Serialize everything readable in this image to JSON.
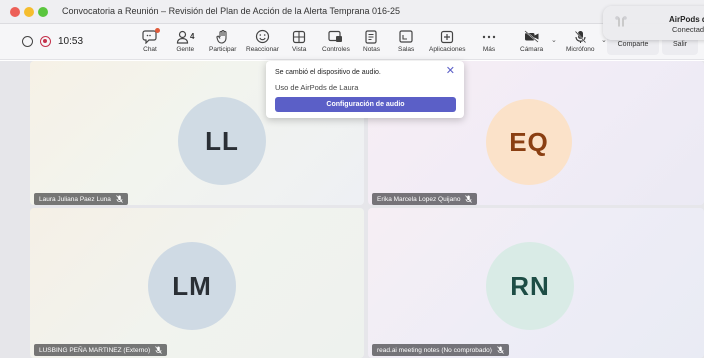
{
  "window": {
    "title": "Convocatoria a Reunión – Revisión del Plan de Acción de la Alerta Temprana 016-25"
  },
  "toolbar": {
    "timer": "10:53",
    "people_count": "4",
    "buttons": [
      {
        "label": "Chat",
        "icon": "chat-icon"
      },
      {
        "label": "Gente",
        "icon": "people-icon"
      },
      {
        "label": "Participar",
        "icon": "raise-hand-icon"
      },
      {
        "label": "Reaccionar",
        "icon": "smiley-icon"
      },
      {
        "label": "Vista",
        "icon": "grid-view-icon"
      },
      {
        "label": "Controles",
        "icon": "controls-icon"
      },
      {
        "label": "Notas",
        "icon": "notes-icon"
      },
      {
        "label": "Salas",
        "icon": "rooms-icon"
      },
      {
        "label": "Aplicaciones",
        "icon": "apps-plus-icon"
      },
      {
        "label": "Más",
        "icon": "more-icon"
      },
      {
        "label": "Cámara",
        "icon": "camera-off-icon"
      },
      {
        "label": "Micrófono",
        "icon": "mic-off-icon"
      }
    ],
    "share_label": "Comparte",
    "leave_label": "Salir"
  },
  "notification": {
    "title": "AirPods de Lau",
    "subtitle": "Conectados"
  },
  "popup": {
    "title": "Se cambió el dispositivo de audio.",
    "subtitle": "Uso de AirPods de Laura",
    "button_label": "Configuración de audio"
  },
  "participants": [
    {
      "initials": "LL",
      "name": "Laura Juliana Paez Luna"
    },
    {
      "initials": "EQ",
      "name": "Erika Marcela Lopez Quijano"
    },
    {
      "initials": "LM",
      "name": "LUSBING PEÑA MARTINEZ (Externo)"
    },
    {
      "initials": "RN",
      "name": "read.ai meeting notes (No comprobado)"
    }
  ]
}
